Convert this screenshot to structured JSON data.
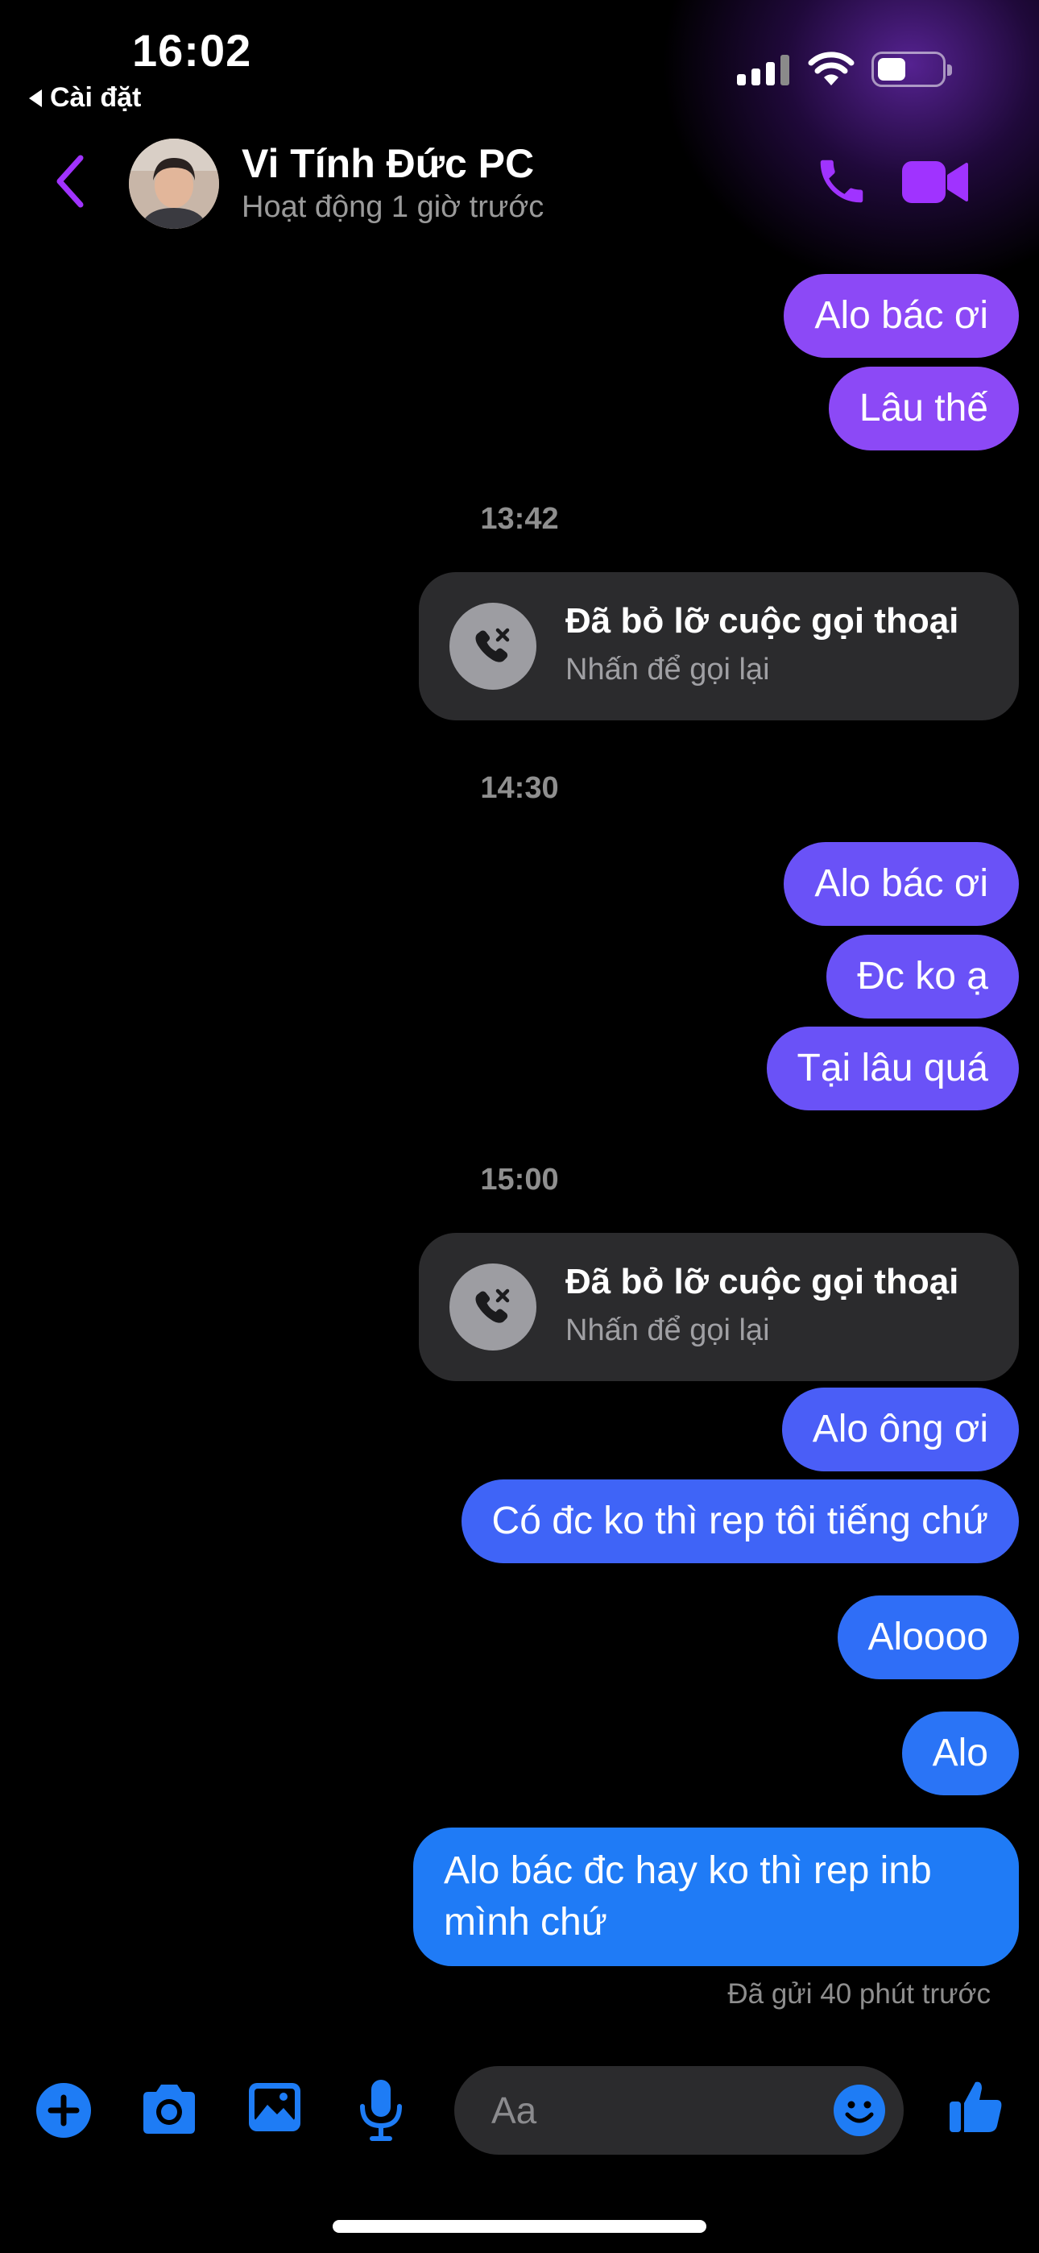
{
  "status_bar": {
    "time": "16:02",
    "back_app": "Cài đặt"
  },
  "header": {
    "name": "Vi Tính Đức PC",
    "status": "Hoạt động 1 giờ trước",
    "accent_color": "#a033ff"
  },
  "messages": [
    {
      "type": "text",
      "text": "Alo bác ơi",
      "color": "#8c49f6"
    },
    {
      "type": "text",
      "text": "Lâu thế",
      "color": "#8c49f6"
    },
    {
      "type": "time",
      "text": "13:42"
    },
    {
      "type": "missed_call",
      "title": "Đã bỏ lỡ cuộc gọi thoại",
      "subtitle": "Nhấn để gọi lại"
    },
    {
      "type": "time",
      "text": "14:30"
    },
    {
      "type": "text",
      "text": "Alo bác ơi",
      "color": "#6a52f7"
    },
    {
      "type": "text",
      "text": "Đc ko ạ",
      "color": "#6a52f7"
    },
    {
      "type": "text",
      "text": "Tại lâu quá",
      "color": "#6a52f7"
    },
    {
      "type": "time",
      "text": "15:00"
    },
    {
      "type": "missed_call",
      "title": "Đã bỏ lỡ cuộc gọi thoại",
      "subtitle": "Nhấn để gọi lại"
    },
    {
      "type": "text",
      "text": "Alo ông ơi",
      "color": "#4a5ef7"
    },
    {
      "type": "text",
      "text": "Có đc ko thì rep tôi tiếng chứ",
      "color": "#3f64f7"
    },
    {
      "type": "text",
      "text": "Aloooo",
      "color": "#2f6ef7"
    },
    {
      "type": "text",
      "text": "Alo",
      "color": "#2a74f6"
    },
    {
      "type": "text",
      "text": "Alo bác đc hay ko thì rep inb mình chứ",
      "color": "#1f7bf6"
    }
  ],
  "sent_status": "Đã gửi 40 phút trước",
  "composer": {
    "placeholder": "Aa",
    "icon_color": "#1e7cf5",
    "icons": [
      "plus-icon",
      "camera-icon",
      "image-icon",
      "microphone-icon",
      "emoji-icon",
      "thumbs-up-icon"
    ]
  }
}
